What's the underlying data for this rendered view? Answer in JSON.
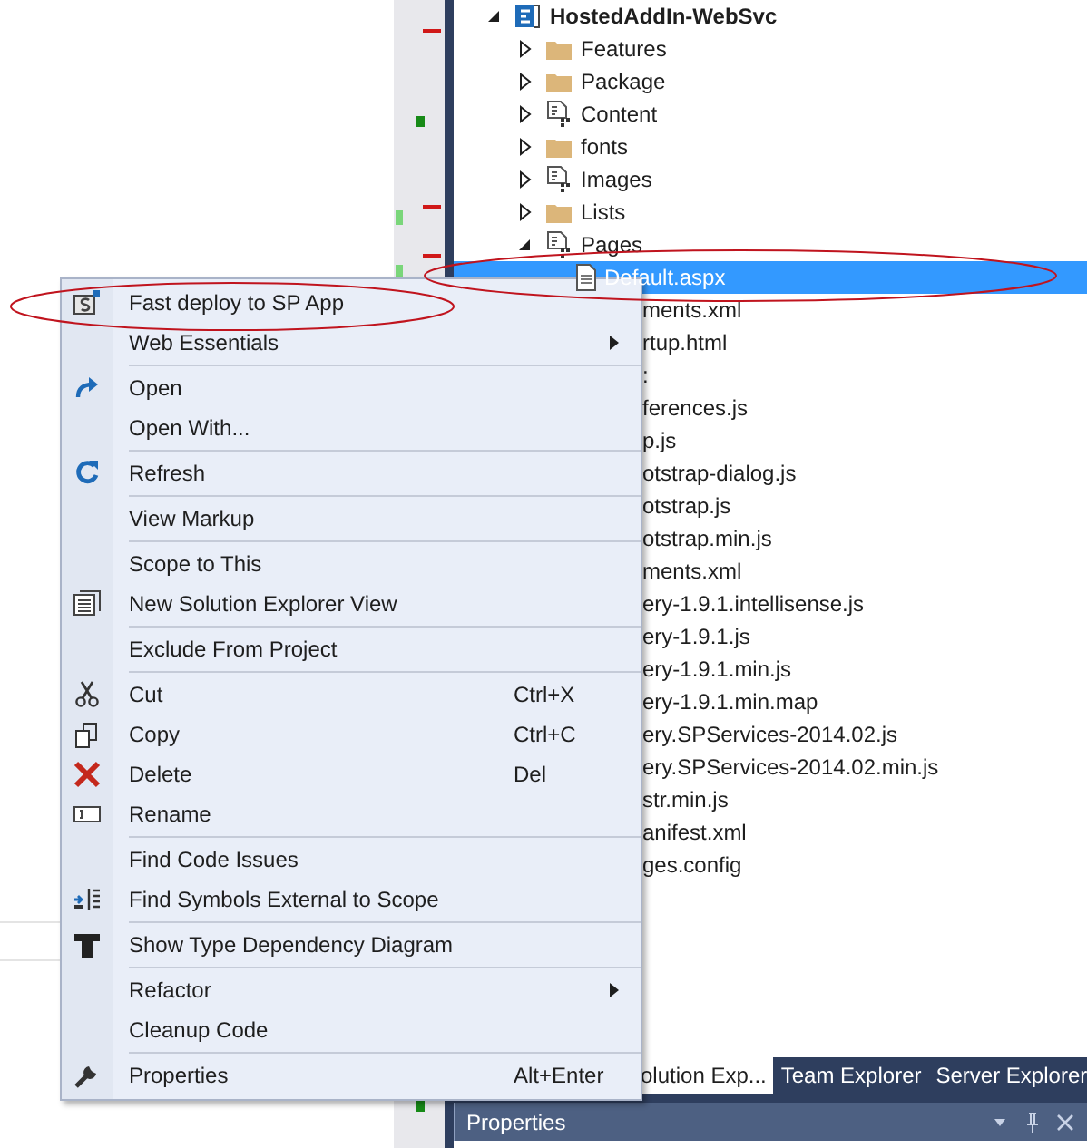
{
  "solution_explorer": {
    "tree": [
      {
        "label": "HostedAddIn-WebSvc",
        "kind": "project",
        "expanded": true,
        "selected": false,
        "children": [
          {
            "label": "Features",
            "kind": "folder",
            "expanded": false,
            "selected": false
          },
          {
            "label": "Package",
            "kind": "folder",
            "expanded": false,
            "selected": false
          },
          {
            "label": "Content",
            "kind": "module",
            "expanded": false,
            "selected": false
          },
          {
            "label": "fonts",
            "kind": "folder",
            "expanded": false,
            "selected": false
          },
          {
            "label": "Images",
            "kind": "module",
            "expanded": false,
            "selected": false
          },
          {
            "label": "Lists",
            "kind": "folder",
            "expanded": false,
            "selected": false
          },
          {
            "label": "Pages",
            "kind": "module",
            "expanded": true,
            "selected": false,
            "children": [
              {
                "label": "Default.aspx",
                "kind": "page",
                "selected": true
              },
              {
                "label": "ments.xml",
                "kind": "clipped",
                "selected": false
              },
              {
                "label": "rtup.html",
                "kind": "clipped",
                "selected": false
              },
              {
                "label": ":",
                "kind": "clipped",
                "selected": false
              },
              {
                "label": "ferences.js",
                "kind": "clipped",
                "selected": false
              },
              {
                "label": "p.js",
                "kind": "clipped",
                "selected": false
              },
              {
                "label": "otstrap-dialog.js",
                "kind": "clipped",
                "selected": false
              },
              {
                "label": "otstrap.js",
                "kind": "clipped",
                "selected": false
              },
              {
                "label": "otstrap.min.js",
                "kind": "clipped",
                "selected": false
              },
              {
                "label": "ments.xml",
                "kind": "clipped",
                "selected": false
              },
              {
                "label": "ery-1.9.1.intellisense.js",
                "kind": "clipped",
                "selected": false
              },
              {
                "label": "ery-1.9.1.js",
                "kind": "clipped",
                "selected": false
              },
              {
                "label": "ery-1.9.1.min.js",
                "kind": "clipped",
                "selected": false
              },
              {
                "label": "ery-1.9.1.min.map",
                "kind": "clipped",
                "selected": false
              },
              {
                "label": "ery.SPServices-2014.02.js",
                "kind": "clipped",
                "selected": false
              },
              {
                "label": "ery.SPServices-2014.02.min.js",
                "kind": "clipped",
                "selected": false
              },
              {
                "label": "str.min.js",
                "kind": "clipped",
                "selected": false
              },
              {
                "label": "anifest.xml",
                "kind": "clipped",
                "selected": false
              },
              {
                "label": "ges.config",
                "kind": "clipped",
                "selected": false
              }
            ]
          }
        ]
      }
    ]
  },
  "tabs": [
    {
      "label": "olution Exp...",
      "selected": true
    },
    {
      "label": "Team Explorer",
      "selected": false
    },
    {
      "label": "Server Explorer",
      "selected": false
    }
  ],
  "properties_panel": {
    "title": "Properties"
  },
  "context_menu": [
    {
      "kind": "item",
      "label": "Fast deploy to SP App",
      "submenu": false
    },
    {
      "kind": "item",
      "label": "Web Essentials",
      "submenu": true
    },
    {
      "kind": "separator"
    },
    {
      "kind": "item",
      "label": "Open",
      "submenu": false
    },
    {
      "kind": "item",
      "label": "Open With...",
      "submenu": false
    },
    {
      "kind": "separator"
    },
    {
      "kind": "item",
      "label": "Refresh",
      "submenu": false
    },
    {
      "kind": "separator"
    },
    {
      "kind": "item",
      "label": "View Markup",
      "submenu": false
    },
    {
      "kind": "separator"
    },
    {
      "kind": "item",
      "label": "Scope to This",
      "submenu": false
    },
    {
      "kind": "item",
      "label": "New Solution Explorer View",
      "submenu": false
    },
    {
      "kind": "separator"
    },
    {
      "kind": "item",
      "label": "Exclude From Project",
      "submenu": false
    },
    {
      "kind": "separator"
    },
    {
      "kind": "item",
      "label": "Cut",
      "shortcut": "Ctrl+X",
      "submenu": false
    },
    {
      "kind": "item",
      "label": "Copy",
      "shortcut": "Ctrl+C",
      "submenu": false
    },
    {
      "kind": "item",
      "label": "Delete",
      "shortcut": "Del",
      "submenu": false
    },
    {
      "kind": "item",
      "label": "Rename",
      "submenu": false
    },
    {
      "kind": "separator"
    },
    {
      "kind": "item",
      "label": "Find Code Issues",
      "submenu": false
    },
    {
      "kind": "item",
      "label": "Find Symbols External to Scope",
      "submenu": false
    },
    {
      "kind": "separator"
    },
    {
      "kind": "item",
      "label": "Show Type Dependency Diagram",
      "submenu": false
    },
    {
      "kind": "separator"
    },
    {
      "kind": "item",
      "label": "Refactor",
      "submenu": true
    },
    {
      "kind": "item",
      "label": "Cleanup Code",
      "submenu": false
    },
    {
      "kind": "separator"
    },
    {
      "kind": "item",
      "label": "Properties",
      "shortcut": "Alt+Enter",
      "submenu": false
    }
  ]
}
